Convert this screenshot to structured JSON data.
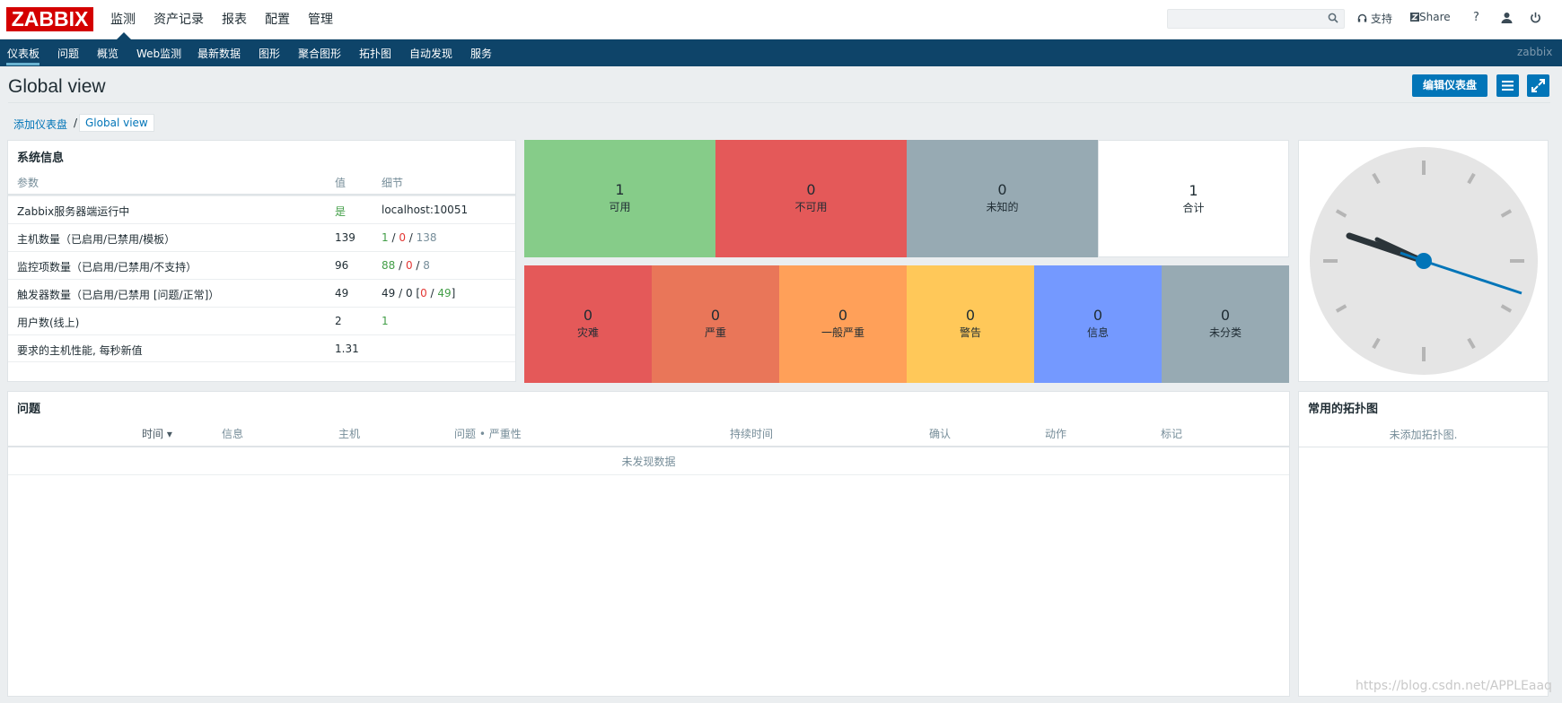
{
  "logo": "ZABBIX",
  "main_menu": [
    "监测",
    "资产记录",
    "报表",
    "配置",
    "管理"
  ],
  "top_right": {
    "support": "支持",
    "share": "Share",
    "help": "?"
  },
  "sub_menu": [
    "仪表板",
    "问题",
    "概览",
    "Web监测",
    "最新数据",
    "图形",
    "聚合图形",
    "拓扑图",
    "自动发现",
    "服务"
  ],
  "current_user": "zabbix",
  "page_title": "Global view",
  "edit_button": "编辑仪表盘",
  "breadcrumb": [
    "添加仪表盘",
    "/",
    "Global view"
  ],
  "system_info": {
    "title": "系统信息",
    "headers": [
      "参数",
      "值",
      "细节"
    ],
    "rows": [
      {
        "param": "Zabbix服务器端运行中",
        "value": "是",
        "detail": "localhost:10051"
      },
      {
        "param": "主机数量（已启用/已禁用/模板）",
        "value": "139",
        "detail": [
          "1",
          " / ",
          "0",
          " / ",
          "138"
        ]
      },
      {
        "param": "监控项数量（已启用/已禁用/不支持）",
        "value": "96",
        "detail": [
          "88",
          " / ",
          "0",
          " / ",
          "8"
        ]
      },
      {
        "param": "触发器数量（已启用/已禁用 [问题/正常]）",
        "value": "49",
        "detail": [
          "49 / 0 [",
          "0",
          " / ",
          "49",
          "]"
        ]
      },
      {
        "param": "用户数(线上)",
        "value": "2",
        "detail": [
          "1"
        ]
      },
      {
        "param": "要求的主机性能, 每秒新值",
        "value": "1.31",
        "detail": ""
      }
    ]
  },
  "host_availability": [
    {
      "count": "1",
      "label": "可用",
      "color": "#86cc89"
    },
    {
      "count": "0",
      "label": "不可用",
      "color": "#e45959"
    },
    {
      "count": "0",
      "label": "未知的",
      "color": "#97aab3"
    },
    {
      "count": "1",
      "label": "合计",
      "color": "#ffffff"
    }
  ],
  "problem_severity": [
    {
      "count": "0",
      "label": "灾难",
      "color": "#e45959"
    },
    {
      "count": "0",
      "label": "严重",
      "color": "#e97659"
    },
    {
      "count": "0",
      "label": "一般严重",
      "color": "#ffa059"
    },
    {
      "count": "0",
      "label": "警告",
      "color": "#ffc859"
    },
    {
      "count": "0",
      "label": "信息",
      "color": "#7499ff"
    },
    {
      "count": "0",
      "label": "未分类",
      "color": "#97aab3"
    }
  ],
  "problems": {
    "title": "问题",
    "headers": [
      "时间 ▾",
      "信息",
      "主机",
      "问题 • 严重性",
      "持续时间",
      "确认",
      "动作",
      "标记"
    ],
    "empty": "未发现数据"
  },
  "favorite_maps": {
    "title": "常用的拓扑图",
    "empty": "未添加拓扑图."
  },
  "watermark": "https://blog.csdn.net/APPLEaaq"
}
